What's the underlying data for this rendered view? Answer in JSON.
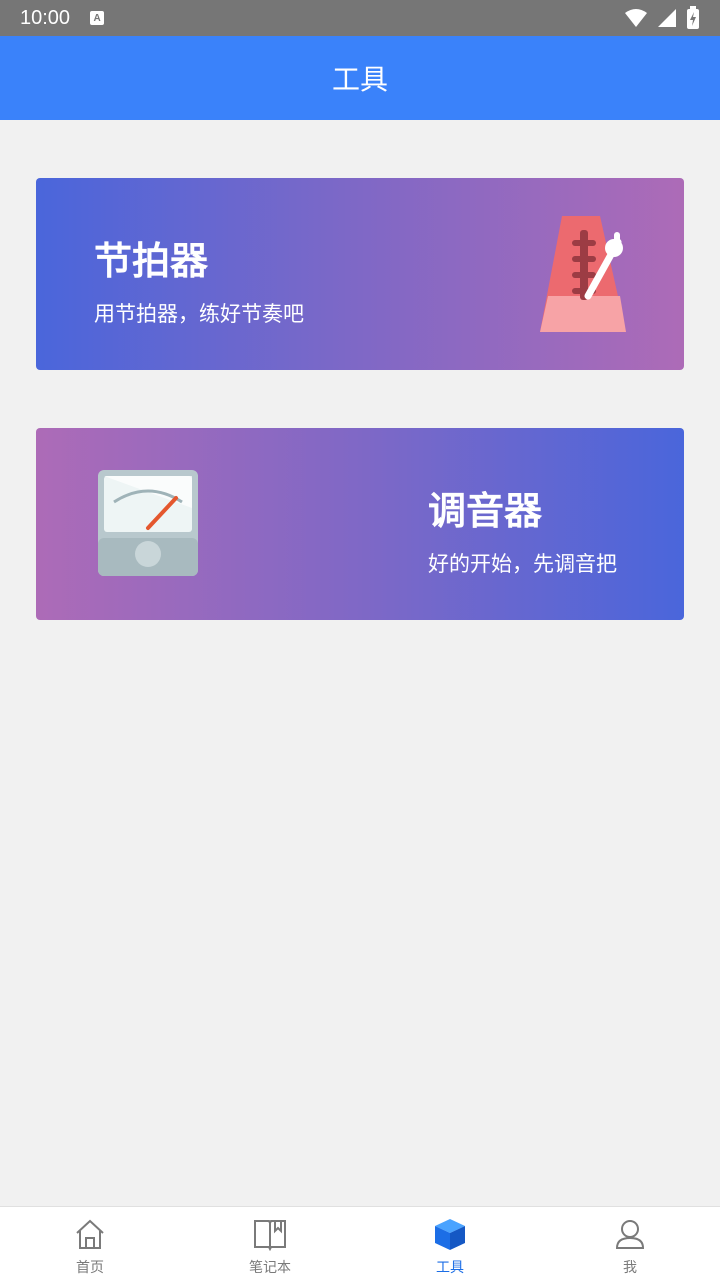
{
  "status_bar": {
    "time": "10:00",
    "notification_icon": "a-icon",
    "indicators": [
      "wifi-icon",
      "signal-icon",
      "battery-icon"
    ]
  },
  "app_bar": {
    "title": "工具"
  },
  "cards": [
    {
      "title": "节拍器",
      "subtitle": "用节拍器，练好节奏吧",
      "icon": "metronome-icon"
    },
    {
      "title": "调音器",
      "subtitle": "好的开始，先调音把",
      "icon": "tuner-icon"
    }
  ],
  "colors": {
    "app_bar": "#3a82fa",
    "card_blue": "#4a66db",
    "card_purple": "#ad6bb7",
    "nav_active": "#1c6ee6",
    "nav_inactive": "#7a7a7a"
  },
  "bottom_nav": {
    "items": [
      {
        "label": "首页",
        "icon": "home-icon",
        "active": false
      },
      {
        "label": "笔记本",
        "icon": "notebook-icon",
        "active": false
      },
      {
        "label": "工具",
        "icon": "cube-icon",
        "active": true
      },
      {
        "label": "我",
        "icon": "user-icon",
        "active": false
      }
    ]
  }
}
